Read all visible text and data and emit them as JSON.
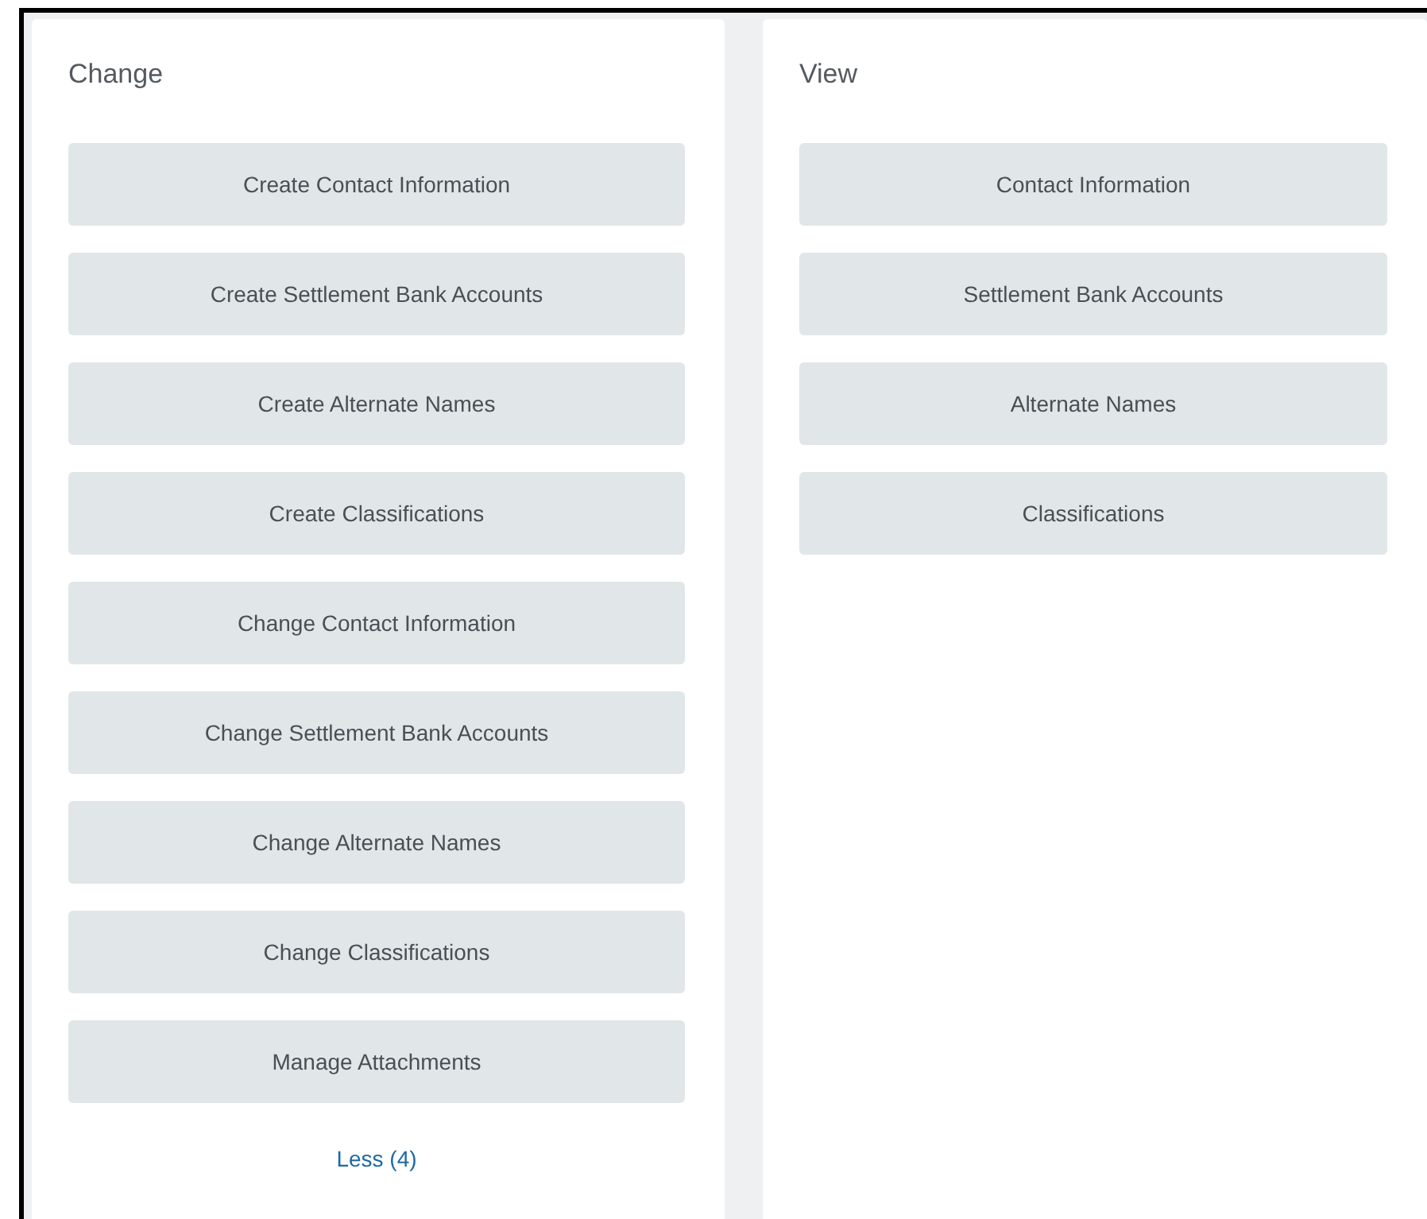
{
  "panels": [
    {
      "title": "Change",
      "buttons": [
        "Create Contact Information",
        "Create Settlement Bank Accounts",
        "Create Alternate Names",
        "Create Classifications",
        "Change Contact Information",
        "Change Settlement Bank Accounts",
        "Change Alternate Names",
        "Change Classifications",
        "Manage Attachments"
      ],
      "link": "Less (4)"
    },
    {
      "title": "View",
      "buttons": [
        "Contact Information",
        "Settlement Bank Accounts",
        "Alternate Names",
        "Classifications"
      ]
    }
  ]
}
